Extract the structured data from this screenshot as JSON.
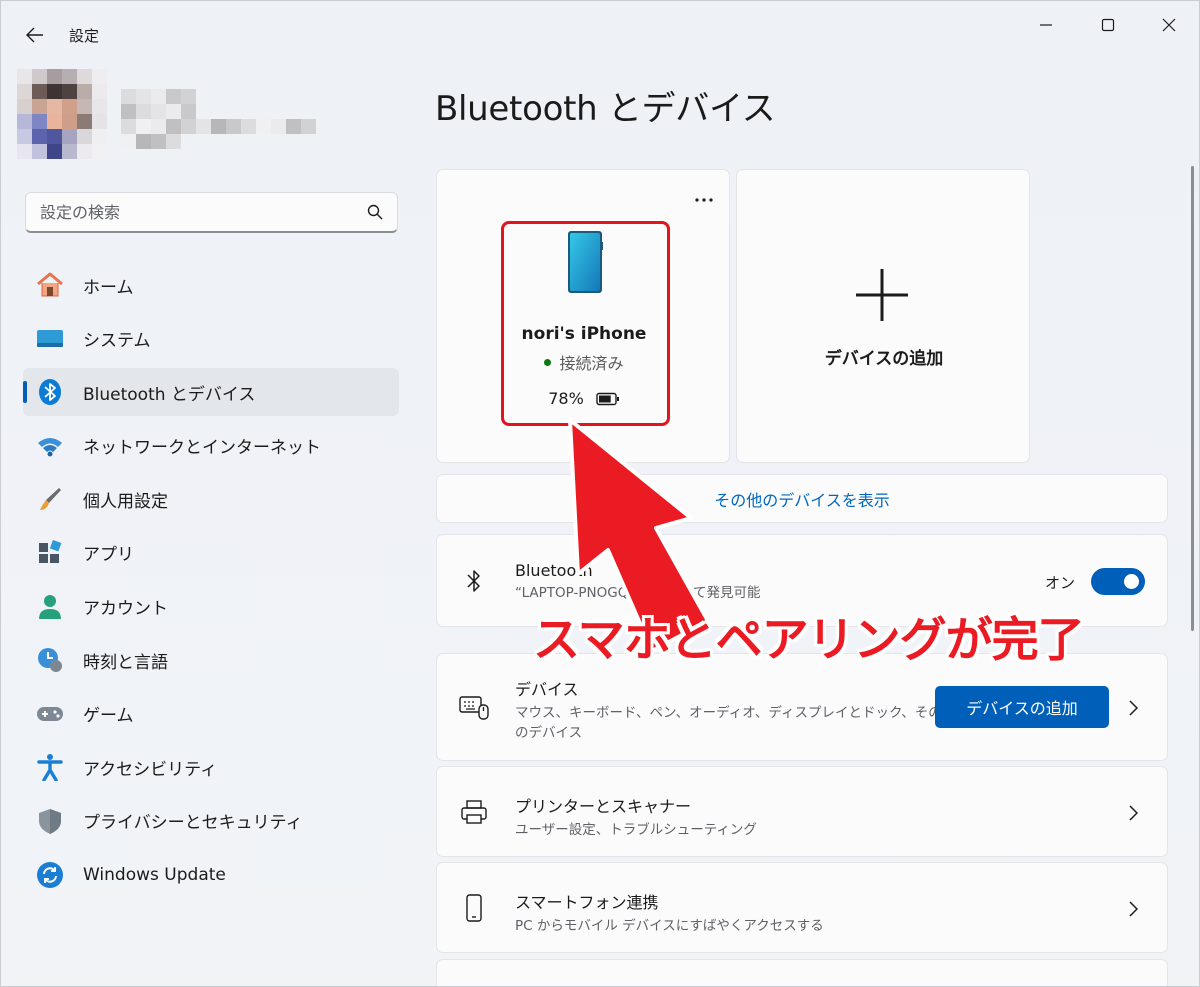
{
  "window": {
    "title": "設定"
  },
  "search": {
    "placeholder": "設定の検索"
  },
  "nav": {
    "items": [
      {
        "label": "ホーム",
        "icon": "home-icon"
      },
      {
        "label": "システム",
        "icon": "system-icon"
      },
      {
        "label": "Bluetooth とデバイス",
        "icon": "bluetooth-icon",
        "active": true
      },
      {
        "label": "ネットワークとインターネット",
        "icon": "wifi-icon"
      },
      {
        "label": "個人用設定",
        "icon": "brush-icon"
      },
      {
        "label": "アプリ",
        "icon": "apps-icon"
      },
      {
        "label": "アカウント",
        "icon": "account-icon"
      },
      {
        "label": "時刻と言語",
        "icon": "time-language-icon"
      },
      {
        "label": "ゲーム",
        "icon": "gamepad-icon"
      },
      {
        "label": "アクセシビリティ",
        "icon": "accessibility-icon"
      },
      {
        "label": "プライバシーとセキュリティ",
        "icon": "shield-icon"
      },
      {
        "label": "Windows Update",
        "icon": "update-icon"
      }
    ]
  },
  "main": {
    "title": "Bluetooth とデバイス",
    "device_card": {
      "name": "nori's iPhone",
      "status": "接続済み",
      "battery": "78%",
      "battery_level": 0.78,
      "more": "···"
    },
    "add_card": {
      "label": "デバイスの追加"
    },
    "more_devices": "その他のデバイスを表示",
    "bluetooth": {
      "title": "Bluetooth",
      "subtitle": "“LAPTOP-PNOGQGF2” として発見可能",
      "toggle_label": "オン",
      "enabled": true
    },
    "devices": {
      "title": "デバイス",
      "subtitle_line1": "マウス、キーボード、ペン、オーディオ、ディスプレイとドック、その他",
      "subtitle_line2": "のデバイス",
      "button": "デバイスの追加"
    },
    "printers": {
      "title": "プリンターとスキャナー",
      "subtitle": "ユーザー設定、トラブルシューティング"
    },
    "phone_link": {
      "title": "スマートフォン連携",
      "subtitle": "PC からモバイル デバイスにすばやくアクセスする"
    }
  },
  "annotation": {
    "text": "スマホとペアリングが完了",
    "color": "#ea1b22"
  },
  "colors": {
    "accent": "#005fb8",
    "link": "#0067c0",
    "connected": "#0f7b0f"
  }
}
